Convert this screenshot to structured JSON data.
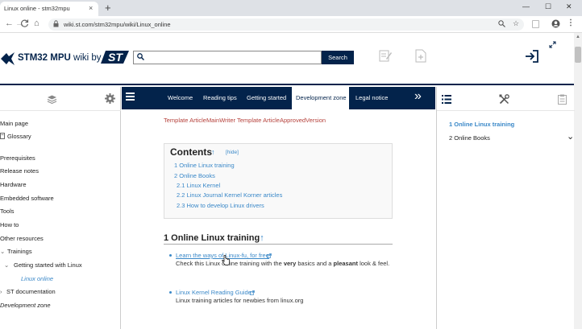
{
  "browser": {
    "tab_title": "Linux online - stm32mpu",
    "tab_close": "×",
    "new_tab": "+",
    "url": "wiki.st.com/stm32mpu/wiki/Linux_online",
    "back": "←",
    "forward": "→",
    "reload": "C",
    "home": "⌂",
    "lock": "🔒",
    "window_min": "—",
    "window_max": "☐",
    "window_close": "✕",
    "menu": "⋮"
  },
  "header": {
    "logo_name": "STM32 MPU",
    "logo_suffix": " wiki by",
    "search_placeholder": "",
    "search_button": "Search"
  },
  "top_nav": {
    "items": [
      "Welcome",
      "Reading tips",
      "Getting started",
      "Development zone",
      "Legal notice"
    ],
    "active": "Development zone",
    "more": "»"
  },
  "left_nav": {
    "items": [
      {
        "label": "Main page"
      },
      {
        "label": "Glossary"
      },
      {
        "label": "Prerequisites"
      },
      {
        "label": "Release notes"
      },
      {
        "label": "Hardware"
      },
      {
        "label": "Embedded software"
      },
      {
        "label": "Tools"
      },
      {
        "label": "How to"
      },
      {
        "label": "Other resources"
      },
      {
        "label": "Trainings"
      },
      {
        "label": "Getting started with Linux"
      },
      {
        "label": "Linux online"
      },
      {
        "label": "ST documentation"
      },
      {
        "label": "Development zone"
      }
    ]
  },
  "main": {
    "template_line": "Template ArticleMainWriter Template ArticleApprovedVersion",
    "toc": {
      "title": "Contents",
      "up_arrow": "↑",
      "hide": "[hide]",
      "items": [
        "1   Online Linux training",
        "2   Online Books",
        "2.1   Linux Kernel",
        "2.2   Linux Journal Kernel Korner articles",
        "2.3   How to develop Linux drivers"
      ]
    },
    "section1_title": "1 Online Linux training",
    "section1_up": "↑",
    "refs": [
      {
        "link": "Learn the ways of Linux-fu, for free",
        "desc_pre": "Check this Linux online training with the ",
        "desc_b1": "very",
        "desc_mid": " basics and a ",
        "desc_b2": "pleasant",
        "desc_post": " look & feel."
      },
      {
        "link": "Linux Kernel Reading Guide",
        "desc_pre": "Linux training articles for newbies from linux.org",
        "desc_b1": "",
        "desc_mid": "",
        "desc_b2": "",
        "desc_post": ""
      }
    ]
  },
  "right_toc": {
    "items": [
      "1 Online Linux training",
      "2 Online Books"
    ],
    "chevron": "⌄"
  },
  "colors": {
    "navy": "#03234b",
    "link": "#3a88c8",
    "template_red": "#b5413b"
  }
}
